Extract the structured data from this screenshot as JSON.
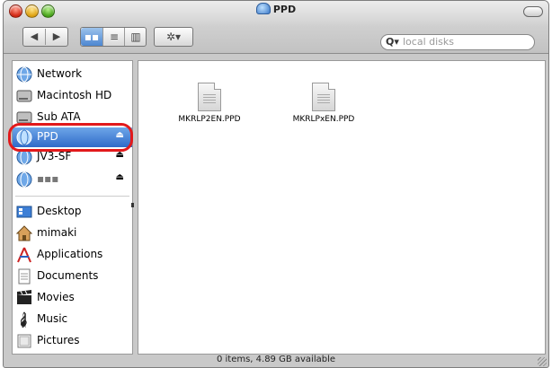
{
  "window": {
    "title": "PPD"
  },
  "toolbar": {
    "back_icon": "◀",
    "forward_icon": "▶",
    "view_icon_symbol": "▪▪",
    "view_list_symbol": "≡",
    "view_column_symbol": "▥",
    "action_label": "✲▾"
  },
  "search": {
    "placeholder": "local disks",
    "icon": "Q▾"
  },
  "sidebar": {
    "items": [
      {
        "label": "Network",
        "icon": "network-icon"
      },
      {
        "label": "Macintosh HD",
        "icon": "hard-disk-icon"
      },
      {
        "label": "Sub ATA",
        "icon": "hard-disk-icon"
      },
      {
        "label": "PPD",
        "icon": "network-volume-icon",
        "selected": true,
        "eject": "⏏"
      },
      {
        "label": "JV3-SF",
        "icon": "network-volume-icon",
        "eject": "⏏"
      },
      {
        "label": "▪▪▪",
        "icon": "network-volume-icon",
        "eject": "⏏"
      },
      {
        "label": "Desktop",
        "icon": "desktop-icon"
      },
      {
        "label": "mimaki",
        "icon": "home-icon"
      },
      {
        "label": "Applications",
        "icon": "applications-icon"
      },
      {
        "label": "Documents",
        "icon": "documents-icon"
      },
      {
        "label": "Movies",
        "icon": "movies-icon"
      },
      {
        "label": "Music",
        "icon": "music-icon"
      },
      {
        "label": "Pictures",
        "icon": "pictures-icon"
      }
    ]
  },
  "files": [
    {
      "name": "MKRLP2EN.PPD",
      "icon": "ppd-document-icon"
    },
    {
      "name": "MKRLPxEN.PPD",
      "icon": "ppd-document-icon"
    }
  ],
  "status": {
    "text": "0 items, 4.89 GB available"
  },
  "colors": {
    "selection": "#2f6bc9",
    "highlight_ring": "#e2191b"
  }
}
